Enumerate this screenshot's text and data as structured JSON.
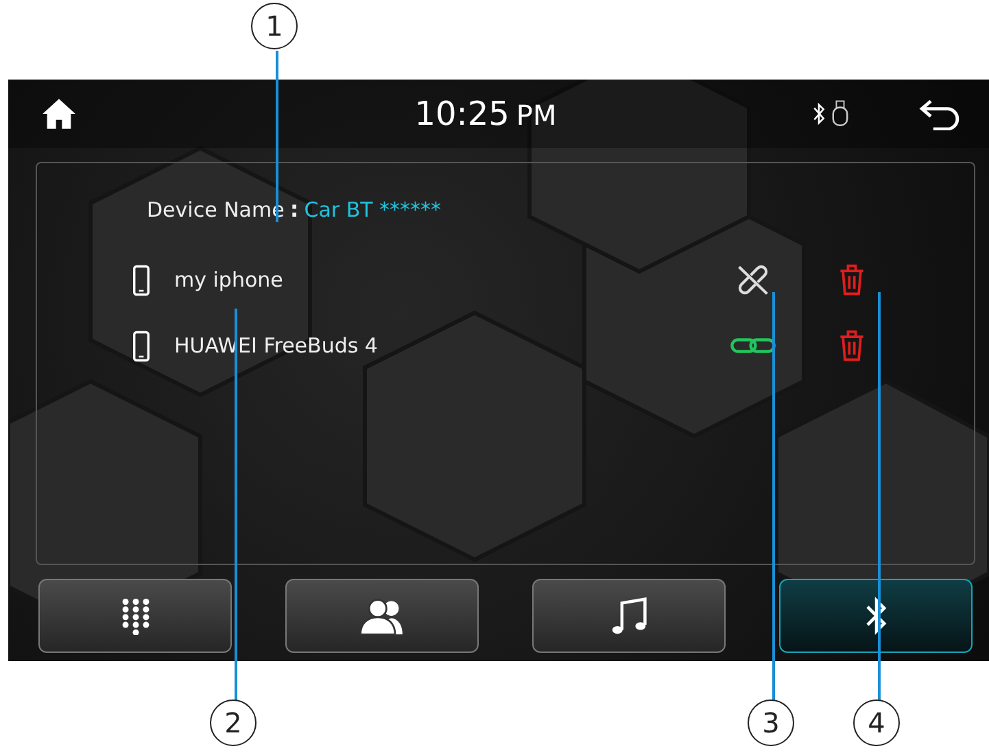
{
  "status_bar": {
    "time": "10:25",
    "meridiem": "PM"
  },
  "device_name": {
    "label": "Device Name",
    "separator": ":",
    "value": "Car BT ******"
  },
  "devices": [
    {
      "name": "my iphone",
      "connected": false
    },
    {
      "name": "HUAWEI FreeBuds 4",
      "connected": true
    }
  ],
  "tabs": [
    {
      "kind": "dialpad",
      "selected": false
    },
    {
      "kind": "contacts",
      "selected": false
    },
    {
      "kind": "music",
      "selected": false
    },
    {
      "kind": "bluetooth",
      "selected": true
    }
  ],
  "callouts": [
    "1",
    "2",
    "3",
    "4"
  ]
}
